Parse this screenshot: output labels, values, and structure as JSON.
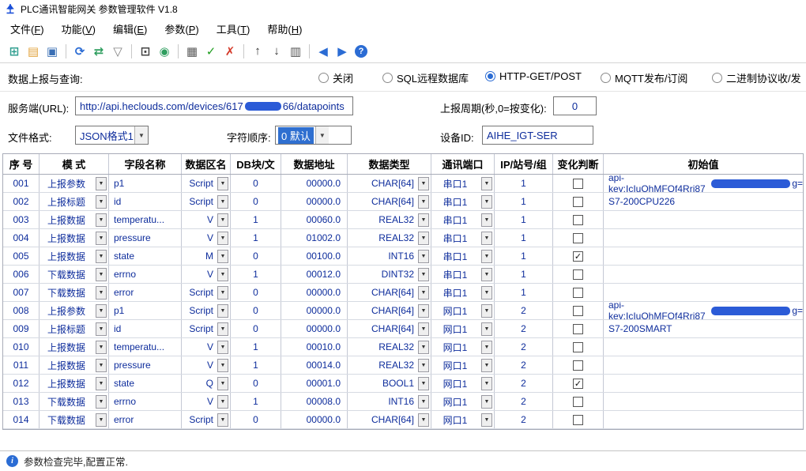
{
  "window": {
    "title": "PLC通讯智能网关 参数管理软件 V1.8"
  },
  "menu": {
    "items": [
      {
        "text": "文件",
        "key": "F"
      },
      {
        "text": "功能",
        "key": "V"
      },
      {
        "text": "编辑",
        "key": "E"
      },
      {
        "text": "参数",
        "key": "P"
      },
      {
        "text": "工具",
        "key": "T"
      },
      {
        "text": "帮助",
        "key": "H"
      }
    ]
  },
  "toolbar": {
    "icons": [
      {
        "name": "ports-icon",
        "glyph": "⊞",
        "color": "#2f9e8f"
      },
      {
        "name": "open-file-icon",
        "glyph": "▤",
        "color": "#e2a33c"
      },
      {
        "name": "save-icon",
        "glyph": "▣",
        "color": "#3a6fb5"
      },
      {
        "sep": true
      },
      {
        "name": "refresh-icon",
        "glyph": "⟳",
        "color": "#2b6cd4"
      },
      {
        "name": "sync-icon",
        "glyph": "⇄",
        "color": "#2f9e5f"
      },
      {
        "name": "filter-icon",
        "glyph": "▽",
        "color": "#808080"
      },
      {
        "sep": true
      },
      {
        "name": "monitor-icon",
        "glyph": "⊡",
        "color": "#444444"
      },
      {
        "name": "network-icon",
        "glyph": "◉",
        "color": "#2f9e5f"
      },
      {
        "sep": true
      },
      {
        "name": "table-icon",
        "glyph": "▦",
        "color": "#5a5a5a"
      },
      {
        "name": "apply-icon",
        "glyph": "✓",
        "color": "#1f9e1f"
      },
      {
        "name": "cancel-icon",
        "glyph": "✗",
        "color": "#d43a2a"
      },
      {
        "sep": true
      },
      {
        "name": "move-up-icon",
        "glyph": "↑",
        "color": "#333333"
      },
      {
        "name": "move-down-icon",
        "glyph": "↓",
        "color": "#333333"
      },
      {
        "name": "ocr-icon",
        "glyph": "▥",
        "color": "#555555"
      },
      {
        "sep": true
      },
      {
        "name": "prev-icon",
        "glyph": "◀",
        "color": "#2b6cd4"
      },
      {
        "name": "next-icon",
        "glyph": "▶",
        "color": "#2b6cd4"
      },
      {
        "name": "help-icon",
        "glyph": "?",
        "color": "#ffffff",
        "circle": "#2b6cd4"
      }
    ]
  },
  "report": {
    "label": "数据上报与查询:",
    "options": [
      {
        "name": "radio-close",
        "label": "关闭",
        "selected": false
      },
      {
        "name": "radio-sql-remote-db",
        "label": "SQL远程数据库",
        "selected": false
      },
      {
        "name": "radio-http-get-post",
        "label": "HTTP-GET/POST",
        "selected": true
      },
      {
        "name": "radio-mqtt-pub-sub",
        "label": "MQTT发布/订阅",
        "selected": false
      },
      {
        "name": "radio-binary-protocol",
        "label": "二进制协议收/发",
        "selected": false
      }
    ]
  },
  "form": {
    "url_label": "服务端(URL):",
    "url_prefix": "http://api.heclouds.com/devices/617",
    "url_redacted": true,
    "url_suffix": "66/datapoints",
    "period_label": "上报周期(秒,0=按变化):",
    "period_value": "0",
    "format_label": "文件格式:",
    "format_value": "JSON格式1",
    "order_label": "字符顺序:",
    "order_value": "0 默认",
    "device_label": "设备ID:",
    "device_value": "AIHE_IGT-SER"
  },
  "table": {
    "headers": [
      "序 号",
      "模 式",
      "字段名称",
      "数据区名",
      "DB块/文",
      "数据地址",
      "数据类型",
      "通讯端口",
      "IP/站号/组",
      "变化判断",
      "初始值"
    ],
    "rows": [
      {
        "seq": "001",
        "mode": "上报参数",
        "field": "p1",
        "area": "Script",
        "db": "0",
        "addr": "00000.0",
        "dtype": "CHAR[64]",
        "port": "串口1",
        "station": "1",
        "checked": false,
        "init": "api-key:IcIuOhMFQf4Rrj87",
        "redacted": true,
        "init_suffix": "g="
      },
      {
        "seq": "002",
        "mode": "上报标题",
        "field": "id",
        "area": "Script",
        "db": "0",
        "addr": "00000.0",
        "dtype": "CHAR[64]",
        "port": "串口1",
        "station": "1",
        "checked": false,
        "init": "S7-200CPU226",
        "redacted": false,
        "init_suffix": ""
      },
      {
        "seq": "003",
        "mode": "上报数据",
        "field": "temperatu...",
        "area": "V",
        "db": "1",
        "addr": "00060.0",
        "dtype": "REAL32",
        "port": "串口1",
        "station": "1",
        "checked": false,
        "init": "",
        "redacted": false,
        "init_suffix": ""
      },
      {
        "seq": "004",
        "mode": "上报数据",
        "field": "pressure",
        "area": "V",
        "db": "1",
        "addr": "01002.0",
        "dtype": "REAL32",
        "port": "串口1",
        "station": "1",
        "checked": false,
        "init": "",
        "redacted": false,
        "init_suffix": ""
      },
      {
        "seq": "005",
        "mode": "上报数据",
        "field": "state",
        "area": "M",
        "db": "0",
        "addr": "00100.0",
        "dtype": "INT16",
        "port": "串口1",
        "station": "1",
        "checked": true,
        "init": "",
        "redacted": false,
        "init_suffix": ""
      },
      {
        "seq": "006",
        "mode": "下载数据",
        "field": "errno",
        "area": "V",
        "db": "1",
        "addr": "00012.0",
        "dtype": "DINT32",
        "port": "串口1",
        "station": "1",
        "checked": false,
        "init": "",
        "redacted": false,
        "init_suffix": ""
      },
      {
        "seq": "007",
        "mode": "下载数据",
        "field": "error",
        "area": "Script",
        "db": "0",
        "addr": "00000.0",
        "dtype": "CHAR[64]",
        "port": "串口1",
        "station": "1",
        "checked": false,
        "init": "",
        "redacted": false,
        "init_suffix": ""
      },
      {
        "seq": "008",
        "mode": "上报参数",
        "field": "p1",
        "area": "Script",
        "db": "0",
        "addr": "00000.0",
        "dtype": "CHAR[64]",
        "port": "网口1",
        "station": "2",
        "checked": false,
        "init": "api-key:IcIuOhMFQf4Rrj87",
        "redacted": true,
        "init_suffix": "g="
      },
      {
        "seq": "009",
        "mode": "上报标题",
        "field": "id",
        "area": "Script",
        "db": "0",
        "addr": "00000.0",
        "dtype": "CHAR[64]",
        "port": "网口1",
        "station": "2",
        "checked": false,
        "init": "S7-200SMART",
        "redacted": false,
        "init_suffix": ""
      },
      {
        "seq": "010",
        "mode": "上报数据",
        "field": "temperatu...",
        "area": "V",
        "db": "1",
        "addr": "00010.0",
        "dtype": "REAL32",
        "port": "网口1",
        "station": "2",
        "checked": false,
        "init": "",
        "redacted": false,
        "init_suffix": ""
      },
      {
        "seq": "011",
        "mode": "上报数据",
        "field": "pressure",
        "area": "V",
        "db": "1",
        "addr": "00014.0",
        "dtype": "REAL32",
        "port": "网口1",
        "station": "2",
        "checked": false,
        "init": "",
        "redacted": false,
        "init_suffix": ""
      },
      {
        "seq": "012",
        "mode": "上报数据",
        "field": "state",
        "area": "Q",
        "db": "0",
        "addr": "00001.0",
        "dtype": "BOOL1",
        "port": "网口1",
        "station": "2",
        "checked": true,
        "init": "",
        "redacted": false,
        "init_suffix": ""
      },
      {
        "seq": "013",
        "mode": "下载数据",
        "field": "errno",
        "area": "V",
        "db": "1",
        "addr": "00008.0",
        "dtype": "INT16",
        "port": "网口1",
        "station": "2",
        "checked": false,
        "init": "",
        "redacted": false,
        "init_suffix": ""
      },
      {
        "seq": "014",
        "mode": "下载数据",
        "field": "error",
        "area": "Script",
        "db": "0",
        "addr": "00000.0",
        "dtype": "CHAR[64]",
        "port": "网口1",
        "station": "2",
        "checked": false,
        "init": "",
        "redacted": false,
        "init_suffix": ""
      }
    ]
  },
  "statusbar": {
    "text": "参数检查完毕,配置正常."
  }
}
